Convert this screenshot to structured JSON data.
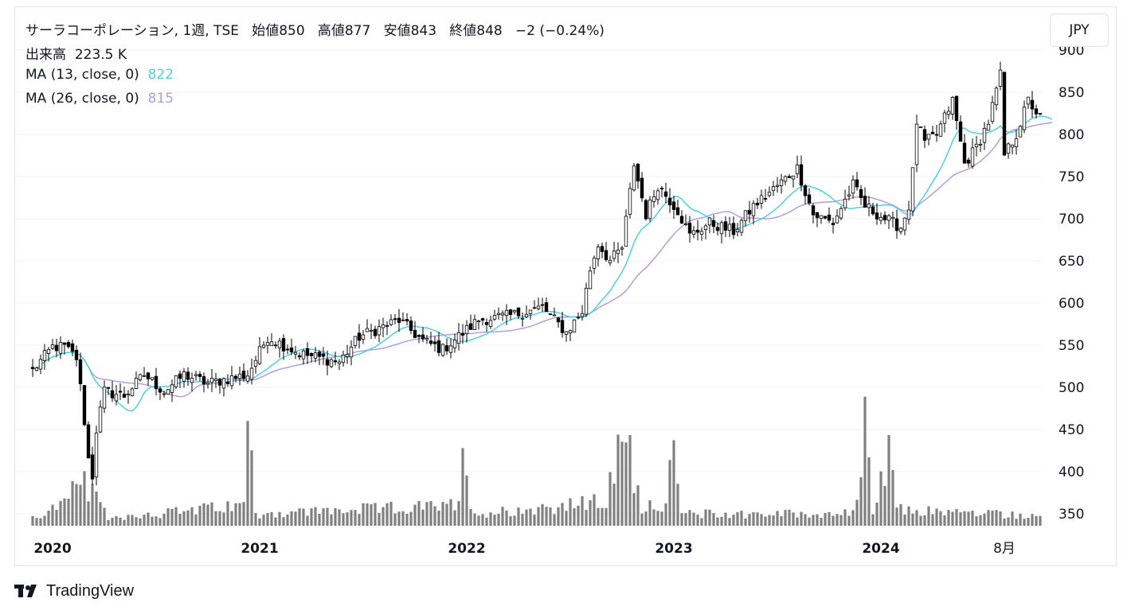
{
  "header": {
    "symbol": "サーラコーポレーション, 1週, TSE",
    "open_label": "始値",
    "open": "850",
    "high_label": "高値",
    "high": "877",
    "low_label": "安値",
    "low": "843",
    "close_label": "終値",
    "close": "848",
    "change": "−2 (−0.24%)"
  },
  "volume_legend": {
    "label": "出来高",
    "value": "223.5 K"
  },
  "ma_legends": [
    {
      "label": "MA (13, close, 0)",
      "value": "822",
      "color": "#4dd0e1"
    },
    {
      "label": "MA (26, close, 0)",
      "value": "815",
      "color": "#b39ddb"
    }
  ],
  "currency_button": "JPY",
  "brand": "TradingView",
  "chart_data": {
    "type": "candlestick",
    "interval": "1 week",
    "price_axis": {
      "ticks": [
        350,
        400,
        450,
        500,
        550,
        600,
        650,
        700,
        750,
        800,
        850,
        900
      ],
      "range": [
        336,
        906
      ],
      "side": "right"
    },
    "time_axis": {
      "labels": [
        "2020",
        "2021",
        "2022",
        "2023",
        "2024",
        "8月"
      ]
    },
    "colors": {
      "up_body": "#ffffff",
      "down_body": "#000000",
      "wick": "#000000",
      "volume": "#808080",
      "ma13": "#4dd0e1",
      "ma26": "#b39ddb",
      "grid": "#f0f3fa",
      "axis_text": "#131722"
    },
    "close_anchors": [
      [
        "2019-12-02",
        520
      ],
      [
        "2020-01-06",
        548
      ],
      [
        "2020-01-27",
        548
      ],
      [
        "2020-02-17",
        535
      ],
      [
        "2020-02-24",
        500
      ],
      [
        "2020-03-02",
        460
      ],
      [
        "2020-03-09",
        415
      ],
      [
        "2020-03-16",
        395
      ],
      [
        "2020-03-23",
        450
      ],
      [
        "2020-04-06",
        495
      ],
      [
        "2020-05-11",
        490
      ],
      [
        "2020-06-15",
        515
      ],
      [
        "2020-07-20",
        495
      ],
      [
        "2020-08-24",
        515
      ],
      [
        "2020-10-05",
        505
      ],
      [
        "2020-12-14",
        515
      ],
      [
        "2021-01-18",
        560
      ],
      [
        "2021-03-15",
        540
      ],
      [
        "2021-05-24",
        530
      ],
      [
        "2021-06-28",
        560
      ],
      [
        "2021-08-02",
        570
      ],
      [
        "2021-09-06",
        580
      ],
      [
        "2021-10-18",
        555
      ],
      [
        "2021-11-22",
        545
      ],
      [
        "2022-01-24",
        580
      ],
      [
        "2022-03-21",
        585
      ],
      [
        "2022-05-16",
        595
      ],
      [
        "2022-06-27",
        565
      ],
      [
        "2022-07-25",
        590
      ],
      [
        "2022-08-08",
        640
      ],
      [
        "2022-08-22",
        670
      ],
      [
        "2022-09-12",
        650
      ],
      [
        "2022-10-03",
        665
      ],
      [
        "2022-10-24",
        765
      ],
      [
        "2022-11-14",
        705
      ],
      [
        "2022-12-05",
        740
      ],
      [
        "2023-01-09",
        710
      ],
      [
        "2023-01-30",
        680
      ],
      [
        "2023-03-06",
        695
      ],
      [
        "2023-04-17",
        685
      ],
      [
        "2023-05-22",
        715
      ],
      [
        "2023-06-26",
        735
      ],
      [
        "2023-08-07",
        760
      ],
      [
        "2023-09-04",
        705
      ],
      [
        "2023-10-09",
        695
      ],
      [
        "2023-11-13",
        740
      ],
      [
        "2023-12-04",
        715
      ],
      [
        "2024-01-08",
        700
      ],
      [
        "2024-02-05",
        690
      ],
      [
        "2024-02-19",
        715
      ],
      [
        "2024-02-26",
        755
      ],
      [
        "2024-03-04",
        815
      ],
      [
        "2024-03-18",
        790
      ],
      [
        "2024-04-08",
        800
      ],
      [
        "2024-05-06",
        840
      ],
      [
        "2024-05-27",
        765
      ],
      [
        "2024-06-17",
        785
      ],
      [
        "2024-07-08",
        815
      ],
      [
        "2024-07-29",
        870
      ],
      [
        "2024-08-05",
        775
      ],
      [
        "2024-08-26",
        800
      ],
      [
        "2024-09-16",
        840
      ],
      [
        "2024-10-07",
        820
      ],
      [
        "2024-10-28",
        848
      ]
    ],
    "volume_anchors": [
      [
        "2019-12-02",
        10
      ],
      [
        "2020-02-03",
        30
      ],
      [
        "2020-02-24",
        62
      ],
      [
        "2020-03-09",
        45
      ],
      [
        "2020-04-13",
        10
      ],
      [
        "2020-12-07",
        25
      ],
      [
        "2020-12-14",
        138
      ],
      [
        "2020-12-28",
        15
      ],
      [
        "2021-12-20",
        25
      ],
      [
        "2021-12-27",
        75
      ],
      [
        "2022-01-17",
        15
      ],
      [
        "2022-09-05",
        30
      ],
      [
        "2022-10-03",
        110
      ],
      [
        "2022-10-17",
        85
      ],
      [
        "2022-11-07",
        25
      ],
      [
        "2022-12-19",
        30
      ],
      [
        "2023-01-02",
        90
      ],
      [
        "2023-01-16",
        15
      ],
      [
        "2023-11-13",
        15
      ],
      [
        "2023-11-27",
        73
      ],
      [
        "2023-12-04",
        150
      ],
      [
        "2023-12-18",
        15
      ],
      [
        "2024-01-15",
        85
      ],
      [
        "2024-01-29",
        20
      ],
      [
        "2024-10-28",
        12
      ]
    ],
    "volume_peak_label": "",
    "last_bar": {
      "date": "2024-10-28",
      "open": 850,
      "high": 877,
      "low": 843,
      "close": 848,
      "volume_k": 223.5
    },
    "ma13_last": 822,
    "ma26_last": 815
  }
}
